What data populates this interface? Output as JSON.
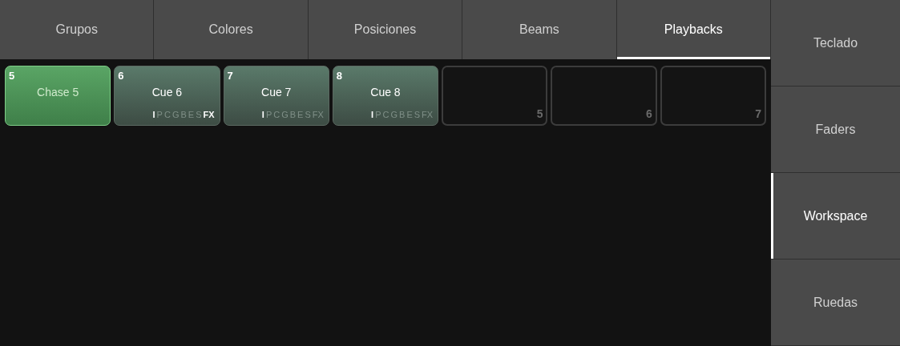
{
  "tabs": [
    {
      "label": "Grupos",
      "selected": false
    },
    {
      "label": "Colores",
      "selected": false
    },
    {
      "label": "Posiciones",
      "selected": false
    },
    {
      "label": "Beams",
      "selected": false
    },
    {
      "label": "Playbacks",
      "selected": true
    }
  ],
  "sidebar": {
    "items": [
      {
        "label": "Teclado",
        "selected": false
      },
      {
        "label": "Faders",
        "selected": false
      },
      {
        "label": "Workspace",
        "selected": true
      },
      {
        "label": "Ruedas",
        "selected": false
      }
    ]
  },
  "playbacks": [
    {
      "kind": "cue",
      "number": "5",
      "name": "Chase 5",
      "selected": true
    },
    {
      "kind": "cue",
      "number": "6",
      "name": "Cue 6",
      "selected": false,
      "flags": [
        {
          "label": "I",
          "on": true
        },
        {
          "label": "P",
          "on": false
        },
        {
          "label": "C",
          "on": false
        },
        {
          "label": "G",
          "on": false
        },
        {
          "label": "B",
          "on": false
        },
        {
          "label": "E",
          "on": false
        },
        {
          "label": "S",
          "on": false
        },
        {
          "label": "FX",
          "on": true
        }
      ]
    },
    {
      "kind": "cue",
      "number": "7",
      "name": "Cue 7",
      "selected": false,
      "flags": [
        {
          "label": "I",
          "on": true
        },
        {
          "label": "P",
          "on": false
        },
        {
          "label": "C",
          "on": false
        },
        {
          "label": "G",
          "on": false
        },
        {
          "label": "B",
          "on": false
        },
        {
          "label": "E",
          "on": false
        },
        {
          "label": "S",
          "on": false
        },
        {
          "label": "FX",
          "on": false
        }
      ]
    },
    {
      "kind": "cue",
      "number": "8",
      "name": "Cue 8",
      "selected": false,
      "flags": [
        {
          "label": "I",
          "on": true
        },
        {
          "label": "P",
          "on": false
        },
        {
          "label": "C",
          "on": false
        },
        {
          "label": "G",
          "on": false
        },
        {
          "label": "B",
          "on": false
        },
        {
          "label": "E",
          "on": false
        },
        {
          "label": "S",
          "on": false
        },
        {
          "label": "FX",
          "on": false
        }
      ]
    },
    {
      "kind": "empty",
      "number": "5"
    },
    {
      "kind": "empty",
      "number": "6"
    },
    {
      "kind": "empty",
      "number": "7"
    }
  ]
}
